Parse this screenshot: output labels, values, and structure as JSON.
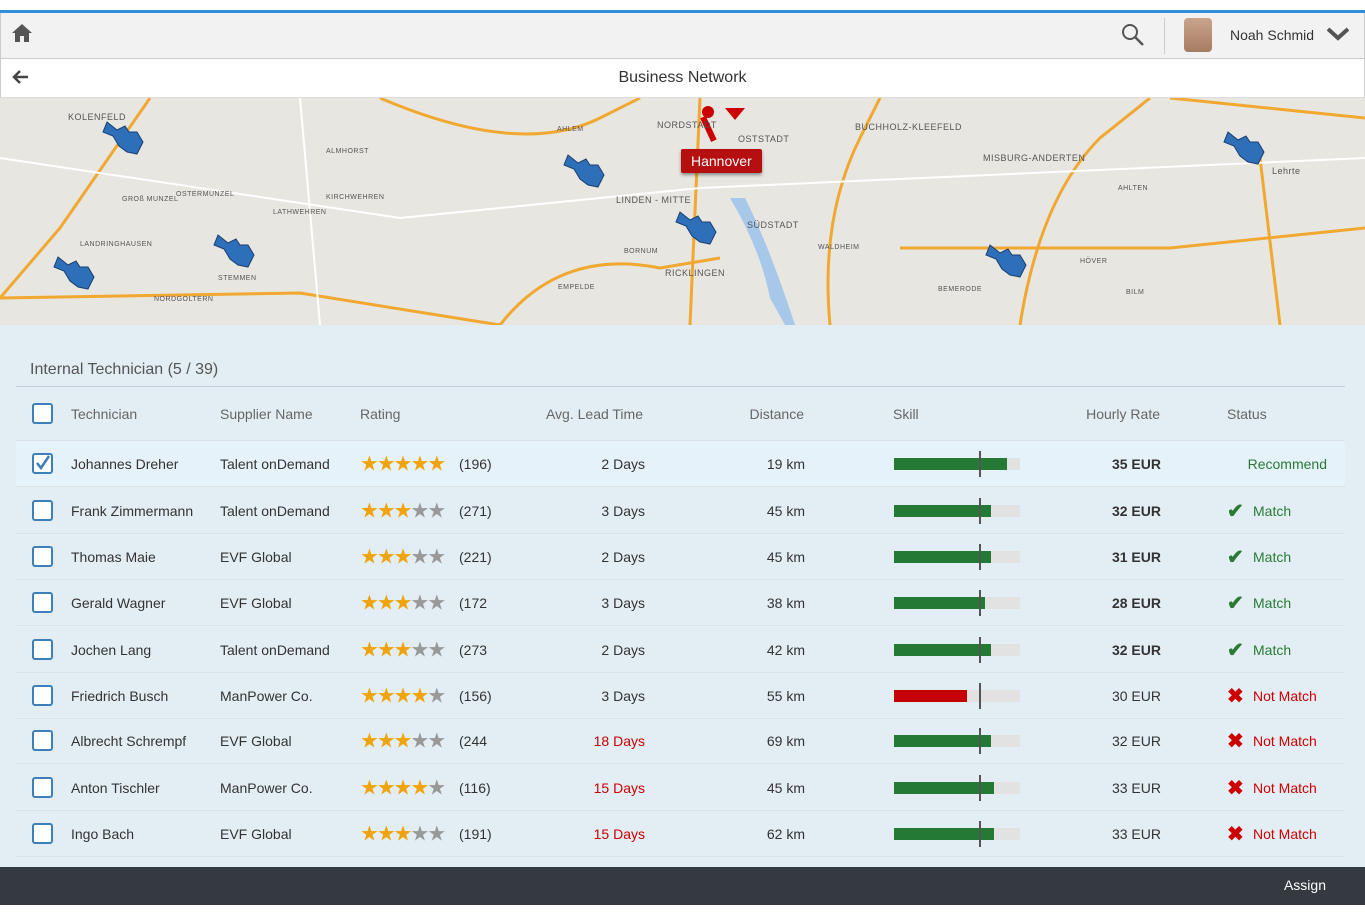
{
  "header": {
    "user_name": "Noah Schmid",
    "page_title": "Business Network"
  },
  "map": {
    "city_label": "Hannover",
    "place_labels": [
      "KOLENFELD",
      "NORDSTADT",
      "OSTSTADT",
      "BUCHHOLZ-KLEEFELD",
      "MISBURG-ANDERTEN",
      "LINDEN - MITTE",
      "SÜDSTADT",
      "RICKLINGEN",
      "Lehrte",
      "LANDRINGHAUSEN",
      "STEMMEN",
      "NORDGOLTERN",
      "ALMHORST",
      "KIRCHWEHREN",
      "LATHWEHREN",
      "GROß MUNZEL",
      "OSTERMUNZEL",
      "AHLEM",
      "BORNUM",
      "EMPELDE",
      "WALDHEIM",
      "BEMERODE",
      "AHLTEN",
      "HÖVER",
      "BILM"
    ]
  },
  "section": {
    "title": "Internal Technician (5 / 39)"
  },
  "table": {
    "headers": {
      "technician": "Technician",
      "supplier": "Supplier Name",
      "rating": "Rating",
      "lead_time": "Avg. Lead Time",
      "distance": "Distance",
      "skill": "Skill",
      "rate": "Hourly Rate",
      "status": "Status"
    },
    "rows": [
      {
        "technician": "Johannes Dreher",
        "supplier": "Talent onDemand",
        "stars": 5,
        "count": "(196)",
        "lead_time": "2 Days",
        "lead_late": false,
        "distance": "19 km",
        "skill": 90,
        "skill_ok": true,
        "rate": "35 EUR",
        "status": "Recommend",
        "status_type": "recommend",
        "selected": true
      },
      {
        "technician": "Frank Zimmermann",
        "supplier": "Talent onDemand",
        "stars": 3,
        "count": "(271)",
        "lead_time": "3 Days",
        "lead_late": false,
        "distance": "45 km",
        "skill": 77,
        "skill_ok": true,
        "rate": "32 EUR",
        "status": "Match",
        "status_type": "match",
        "selected": false
      },
      {
        "technician": "Thomas Maie",
        "supplier": "EVF Global",
        "stars": 3,
        "count": "(221)",
        "lead_time": "2 Days",
        "lead_late": false,
        "distance": "45 km",
        "skill": 77,
        "skill_ok": true,
        "rate": "31 EUR",
        "status": "Match",
        "status_type": "match",
        "selected": false
      },
      {
        "technician": "Gerald Wagner",
        "supplier": "EVF Global",
        "stars": 3,
        "count": "(172",
        "lead_time": "3 Days",
        "lead_late": false,
        "distance": "38 km",
        "skill": 72,
        "skill_ok": true,
        "rate": "28 EUR",
        "status": "Match",
        "status_type": "match",
        "selected": false
      },
      {
        "technician": "Jochen Lang",
        "supplier": "Talent onDemand",
        "stars": 3,
        "count": "(273",
        "lead_time": "2 Days",
        "lead_late": false,
        "distance": "42 km",
        "skill": 77,
        "skill_ok": true,
        "rate": "32 EUR",
        "status": "Match",
        "status_type": "match",
        "selected": false
      },
      {
        "technician": "Friedrich Busch",
        "supplier": "ManPower Co.",
        "stars": 4,
        "count": "(156)",
        "lead_time": "3 Days",
        "lead_late": false,
        "distance": "55 km",
        "skill": 58,
        "skill_ok": false,
        "rate": "30 EUR",
        "status": "Not Match",
        "status_type": "nomatch",
        "selected": false
      },
      {
        "technician": "Albrecht Schrempf",
        "supplier": "EVF Global",
        "stars": 3,
        "count": "(244",
        "lead_time": "18 Days",
        "lead_late": true,
        "distance": "69 km",
        "skill": 77,
        "skill_ok": true,
        "rate": "32 EUR",
        "status": "Not Match",
        "status_type": "nomatch",
        "selected": false
      },
      {
        "technician": "Anton  Tischler",
        "supplier": "ManPower Co.",
        "stars": 4,
        "count": "(116)",
        "lead_time": "15 Days",
        "lead_late": true,
        "distance": "45 km",
        "skill": 79,
        "skill_ok": true,
        "rate": "33 EUR",
        "status": "Not Match",
        "status_type": "nomatch",
        "selected": false
      },
      {
        "technician": "Ingo Bach",
        "supplier": "EVF Global",
        "stars": 3,
        "count": "(191)",
        "lead_time": "15 Days",
        "lead_late": true,
        "distance": "62 km",
        "skill": 79,
        "skill_ok": true,
        "rate": "33 EUR",
        "status": "Not Match",
        "status_type": "nomatch",
        "selected": false
      }
    ]
  },
  "footer": {
    "assign_label": "Assign"
  },
  "colors": {
    "accent": "#2f8fd8",
    "match": "#2a7a35",
    "not_match": "#cc0000",
    "footer": "#353a40"
  }
}
